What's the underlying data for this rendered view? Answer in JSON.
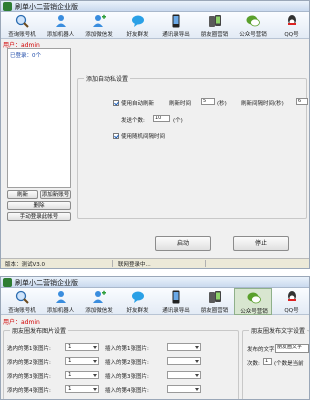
{
  "window1": {
    "title": "刷单小二营销企业版",
    "user_label": "用户：admin",
    "tools": [
      {
        "label": "查询账号机",
        "icon": "magnifier-globe-icon",
        "color": "#2b6cb0"
      },
      {
        "label": "添加机器人",
        "icon": "robot-icon",
        "color": "#3a8dde"
      },
      {
        "label": "添加微信发",
        "icon": "add-contact-icon",
        "color": "#3a8dde"
      },
      {
        "label": "好友群发",
        "icon": "chat-bubble-icon",
        "color": "#2aa0e6"
      },
      {
        "label": "通讯录导出",
        "icon": "phone-icon",
        "color": "#222222"
      },
      {
        "label": "朋友圈营销",
        "icon": "phone-cards-icon",
        "color": "#444444"
      },
      {
        "label": "公众号营销",
        "icon": "wechat-bubble-icon",
        "color": "#5aa02c"
      },
      {
        "label": "QQ号",
        "icon": "qq-icon",
        "color": "#333333"
      }
    ],
    "left_panel": {
      "title": "已登录：0个",
      "buttons": [
        "刷新",
        "添加新账号",
        "删除",
        "手动登录此帐号"
      ]
    },
    "settings": {
      "group_title": "添加自动私设置",
      "auto_refresh_label": "使用自动刷新",
      "interval_label": "刷新时间",
      "interval_value": "5",
      "interval_unit": "(秒)",
      "per_label": "刷新间隔时间(秒)",
      "per_value": "6",
      "count_label": "发送个数:",
      "count_value": "10",
      "count_unit": "(个)",
      "random_label": "使用随机间隔时间"
    },
    "start_button": "启动",
    "stop_button": "停止",
    "status": {
      "version": "版本：测试V3.0",
      "tip": "联网登录中..."
    }
  },
  "window2": {
    "title": "刷单小二营销企业版",
    "user_label": "用户：admin",
    "tools": [
      {
        "label": "查询账号机",
        "icon": "magnifier-globe-icon",
        "color": "#2b6cb0"
      },
      {
        "label": "添加机器人",
        "icon": "robot-icon",
        "color": "#3a8dde"
      },
      {
        "label": "添加微信发",
        "icon": "add-contact-icon",
        "color": "#3a8dde"
      },
      {
        "label": "好友群发",
        "icon": "chat-bubble-icon",
        "color": "#2aa0e6"
      },
      {
        "label": "通讯录导出",
        "icon": "phone-icon",
        "color": "#222222"
      },
      {
        "label": "朋友圈营销",
        "icon": "phone-cards-icon",
        "color": "#444444"
      },
      {
        "label": "公众号营销",
        "icon": "wechat-bubble-icon",
        "color": "#5aa02c"
      },
      {
        "label": "QQ号",
        "icon": "qq-icon",
        "color": "#333333"
      }
    ],
    "active_tool": 6,
    "left_group_title": "朋友圈发布图片设置",
    "rows": [
      {
        "label_a": "选内的第1张图片:",
        "val_a": "1",
        "label_b": "插入的第1张图片:"
      },
      {
        "label_a": "添内的第2张图片:",
        "val_a": "1",
        "label_b": "插入的第2张图片:"
      },
      {
        "label_a": "添内的第3张图片:",
        "val_a": "1",
        "label_b": "插入的第3张图片:"
      },
      {
        "label_a": "添内的第4张图片:",
        "val_a": "1",
        "label_b": "插入的第4张图片:"
      }
    ],
    "right_group_title": "朋友圈发布文字设置",
    "right_send_label": "发布的文字:",
    "right_send_value": "朋友圈文字",
    "right_count_label": "次数:",
    "right_count_value": "1",
    "right_count_note": "(个数是当前"
  }
}
